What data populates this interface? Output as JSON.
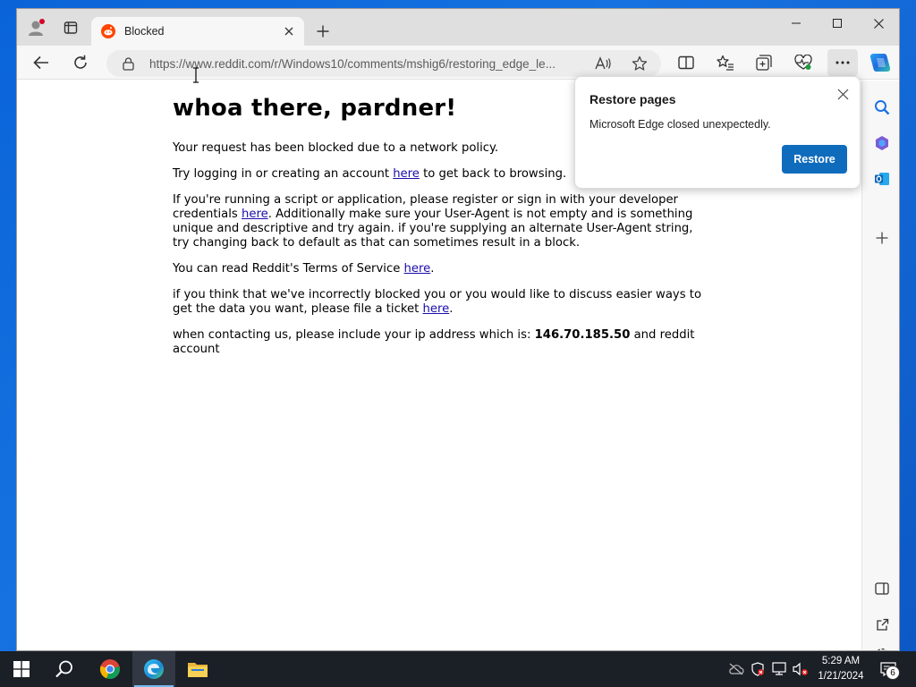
{
  "browser": {
    "tab": {
      "title": "Blocked",
      "favicon": "reddit-favicon-icon"
    },
    "address_bar": {
      "url": "https://www.reddit.com/r/Windows10/comments/mshig6/restoring_edge_le..."
    },
    "window_controls": [
      "minimize-icon",
      "maximize-icon",
      "close-icon"
    ]
  },
  "page": {
    "heading": "whoa there, pardner!",
    "p1": "Your request has been blocked due to a network policy.",
    "p2_before": "Try logging in or creating an account ",
    "p2_link": "here",
    "p2_after": " to get back to browsing.",
    "p3_before": "If you're running a script or application, please register or sign in with your developer credentials ",
    "p3_link": "here",
    "p3_after": ". Additionally make sure your User-Agent is not empty and is something unique and descriptive and try again. if you're supplying an alternate User-Agent string, try changing back to default as that can sometimes result in a block.",
    "p4_before": "You can read Reddit's Terms of Service ",
    "p4_link": "here",
    "p4_after": ".",
    "p5_before": "if you think that we've incorrectly blocked you or you would like to discuss easier ways to get the data you want, please file a ticket ",
    "p5_link": "here",
    "p5_after": ".",
    "p6_before": "when contacting us, please include your ip address which is: ",
    "p6_ip": "146.70.185.50",
    "p6_after": " and reddit account"
  },
  "popup": {
    "title": "Restore pages",
    "message": "Microsoft Edge closed unexpectedly.",
    "button": "Restore"
  },
  "taskbar": {
    "apps": [
      "start-icon",
      "search-icon",
      "chrome-icon",
      "edge-icon",
      "file-explorer-icon"
    ],
    "time": "5:29 AM",
    "date": "1/21/2024",
    "notification_count": "6"
  },
  "colors": {
    "accent": "#0f6cbd",
    "link": "#1a0dab",
    "taskbar": "#1b1f26"
  }
}
